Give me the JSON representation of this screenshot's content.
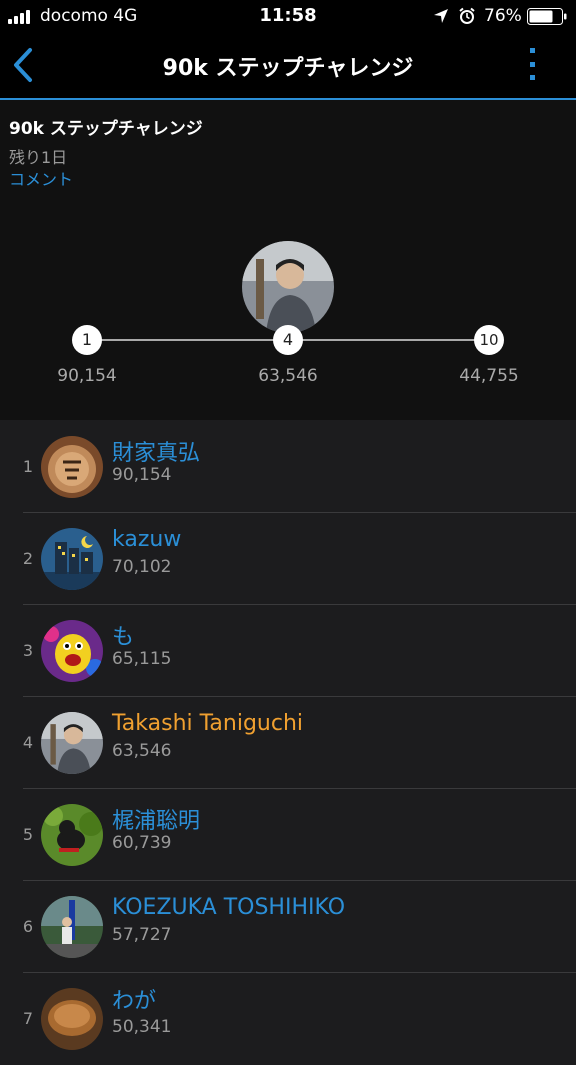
{
  "status_bar": {
    "carrier": "docomo   4G",
    "time": "11:58",
    "battery": "76%"
  },
  "nav": {
    "title": "90k ステップチャレンジ",
    "back_icon": "chevron-left-icon",
    "more_icon": "vertical-dots-icon"
  },
  "challenge": {
    "title": "90k ステップチャレンジ",
    "remaining": "残り1日",
    "comment_link": "コメント"
  },
  "progress": {
    "nodes": [
      {
        "rank": "1",
        "value": "90,154"
      },
      {
        "rank": "4",
        "value": "63,546"
      },
      {
        "rank": "10",
        "value": "44,755"
      }
    ]
  },
  "leaderboard": [
    {
      "rank": "1",
      "name": "財家真弘",
      "steps": "90,154"
    },
    {
      "rank": "2",
      "name": "kazuw",
      "steps": "70,102"
    },
    {
      "rank": "3",
      "name": "も",
      "steps": "65,115"
    },
    {
      "rank": "4",
      "name": "Takashi Taniguchi",
      "steps": "63,546"
    },
    {
      "rank": "5",
      "name": "梶浦聡明",
      "steps": "60,739"
    },
    {
      "rank": "6",
      "name": "KOEZUKA TOSHIHIKO",
      "steps": "57,727"
    },
    {
      "rank": "7",
      "name": "わが",
      "steps": "50,341"
    }
  ],
  "colors": {
    "accent": "#2b8fd7",
    "self_highlight": "#f0a030",
    "background": "#1c1c1e",
    "header_background": "#111111"
  }
}
